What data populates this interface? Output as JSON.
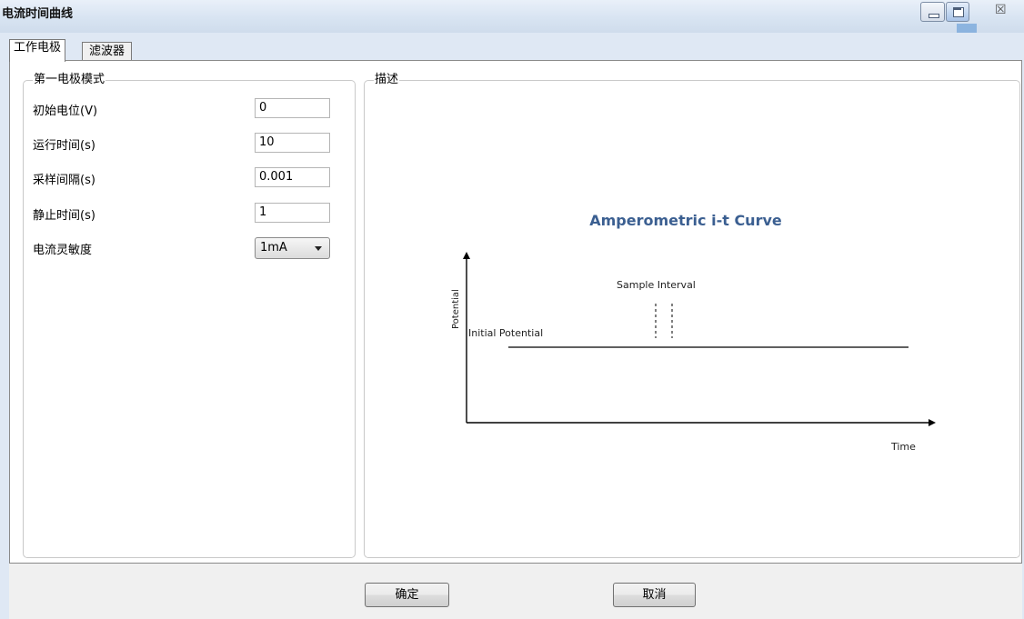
{
  "window": {
    "title": "电流时间曲线",
    "controls": {
      "minimize_icon": "minimize-icon",
      "maximize_icon": "maximize-icon",
      "close_icon": "close-icon",
      "close_glyph": "☒"
    }
  },
  "tabs": [
    {
      "label": "工作电极",
      "active": true
    },
    {
      "label": "滤波器",
      "active": false
    }
  ],
  "left_group": {
    "legend": "第一电极模式",
    "fields": [
      {
        "label": "初始电位(V)",
        "value": "0"
      },
      {
        "label": "运行时间(s)",
        "value": "10"
      },
      {
        "label": "采样间隔(s)",
        "value": "0.001"
      },
      {
        "label": "静止时间(s)",
        "value": "1"
      }
    ],
    "sensitivity": {
      "label": "电流灵敏度",
      "selected": "1mA"
    }
  },
  "right_group": {
    "legend": "描述",
    "diagram": {
      "title": "Amperometric i-t Curve",
      "y_axis_label": "Potential",
      "x_axis_label": "Time",
      "initial_potential_label": "Initial Potential",
      "sample_interval_label": "Sample Interval"
    }
  },
  "footer": {
    "ok_label": "确定",
    "cancel_label": "取消"
  },
  "colors": {
    "titlebar": "#dfe8f4",
    "diagram_title": "#3b5f91",
    "axis": "#000000"
  }
}
